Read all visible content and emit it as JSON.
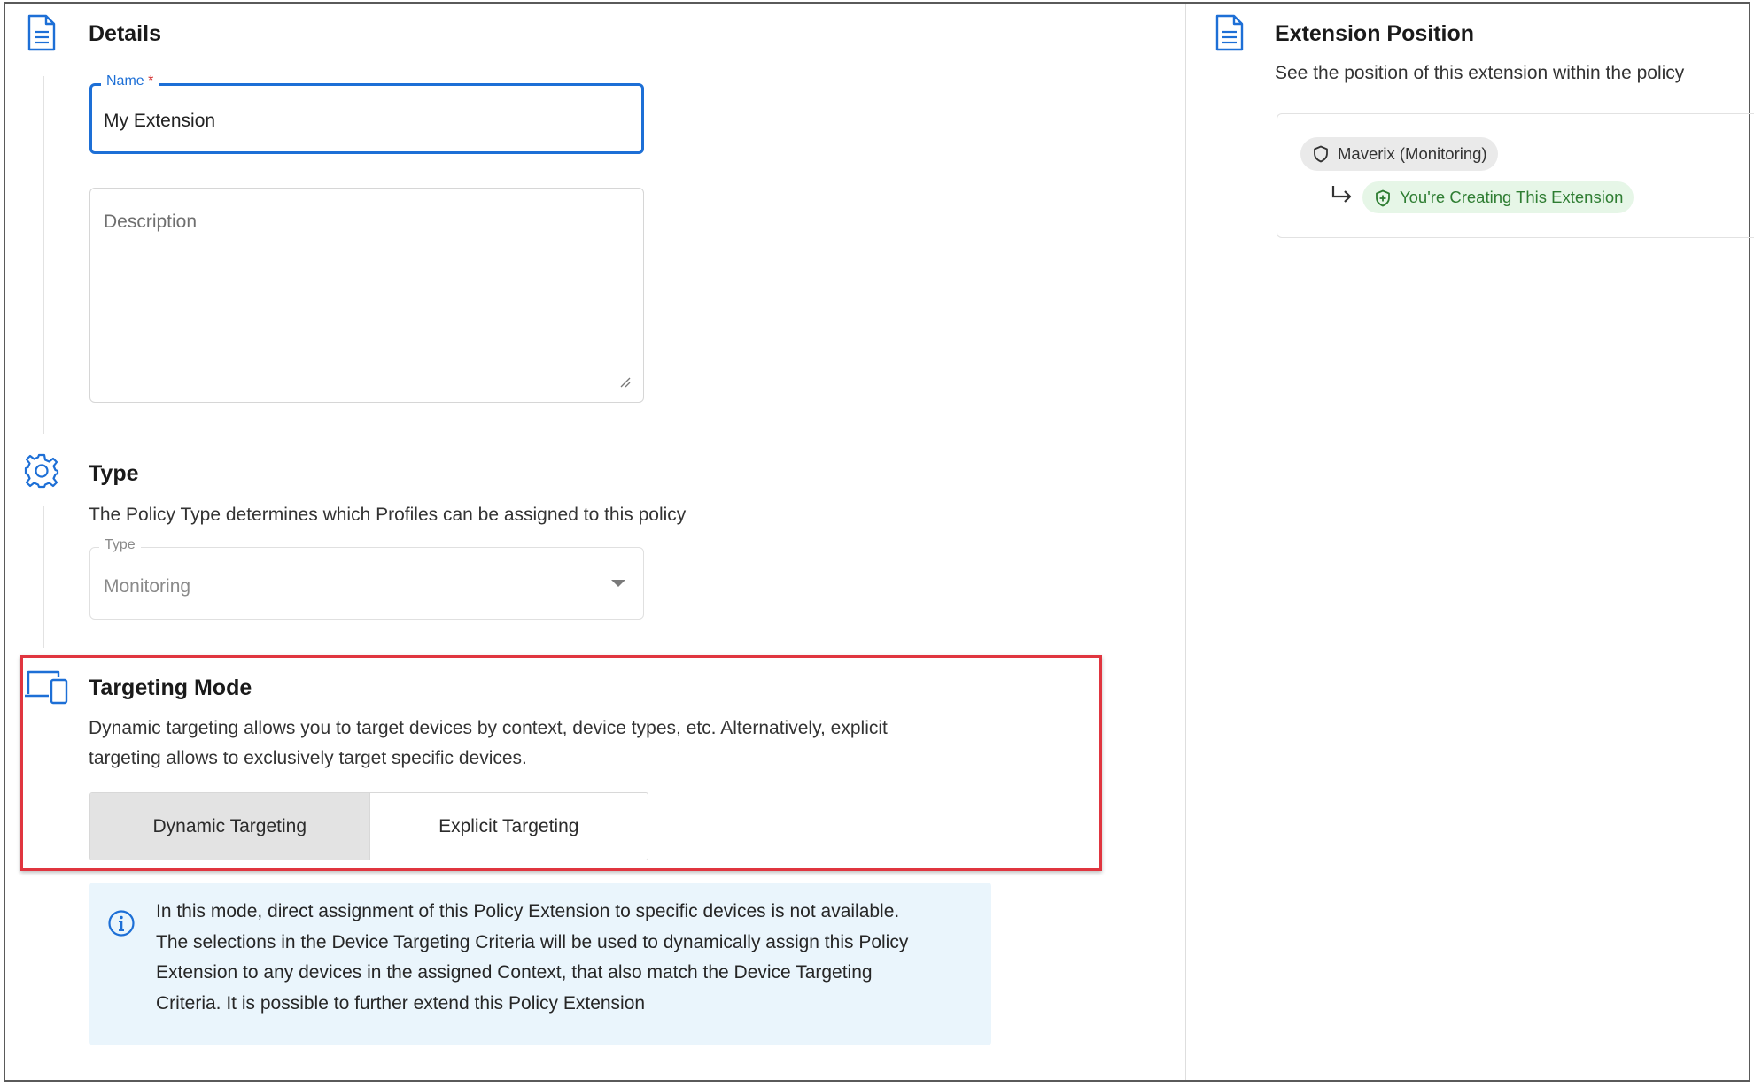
{
  "details": {
    "title": "Details",
    "name_label": "Name",
    "name_required_mark": "*",
    "name_value": "My Extension",
    "description_placeholder": "Description"
  },
  "type_section": {
    "title": "Type",
    "description": "The Policy Type determines which Profiles can be assigned to this policy",
    "select_label": "Type",
    "select_value": "Monitoring"
  },
  "targeting": {
    "title": "Targeting Mode",
    "description_line1": "Dynamic targeting allows you to target devices by context, device types, etc. Alternatively, explicit",
    "description_line2": "targeting allows to exclusively target specific devices.",
    "options": [
      {
        "label": "Dynamic Targeting",
        "selected": true
      },
      {
        "label": "Explicit Targeting",
        "selected": false
      }
    ],
    "info_line1": "In this mode, direct assignment of this Policy Extension to specific devices is not available.",
    "info_line2": "The selections in the Device Targeting Criteria will be used to dynamically assign this Policy",
    "info_line3": "Extension to any devices in the assigned Context, that also match the Device Targeting",
    "info_line4": "Criteria. It is possible to further extend this Policy Extension"
  },
  "extension_position": {
    "title": "Extension Position",
    "description": "See the position of this extension within the policy",
    "parent_chip": "Maverix (Monitoring)",
    "current_chip": "You're Creating This Extension"
  },
  "colors": {
    "accent": "#1d6fd6",
    "highlight_border": "#e0353f",
    "info_bg": "#eaf5fc",
    "success_text": "#2e7d32",
    "success_bg": "#e6f6e7"
  },
  "icons": {
    "details": "document-icon",
    "type": "gear-icon",
    "targeting": "devices-icon",
    "info": "info-icon",
    "extension_position": "document-icon",
    "parent_chip": "shield-icon",
    "current_chip": "shield-plus-icon",
    "connector": "return-arrow-icon"
  }
}
